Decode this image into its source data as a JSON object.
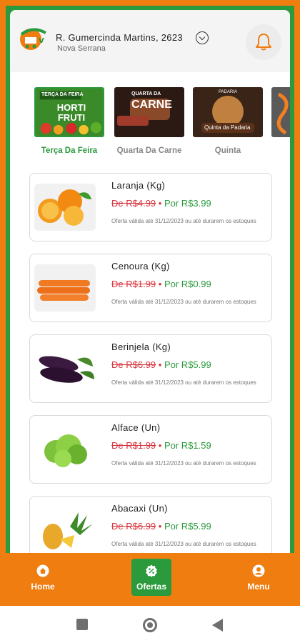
{
  "header": {
    "address": "R. Gumercinda Martins,  2623",
    "city": "Nova Serrana"
  },
  "categories": [
    {
      "label": "Terça Da Feira",
      "thumb_text_top": "TERÇA DA FEIRA",
      "thumb_text_main": "HORTI FRUTI",
      "active": true
    },
    {
      "label": "Quarta Da Carne",
      "thumb_text_top": "QUARTA DA",
      "thumb_text_main": "CARNE",
      "active": false
    },
    {
      "label": "Quinta",
      "thumb_text_top": "PADARIA",
      "thumb_text_main": "Quinta da Padaria",
      "active": false
    }
  ],
  "products": [
    {
      "name": "Laranja (Kg)",
      "old_price": "De R$4.99",
      "separator": "•",
      "new_price": "Por R$3.99",
      "validity": "Oferta válida até 31/12/2023  ou até durarem os estoques",
      "icon": "orange-fruit"
    },
    {
      "name": "Cenoura (Kg)",
      "old_price": "De R$1.99",
      "separator": "•",
      "new_price": "Por R$0.99",
      "validity": "Oferta válida até 31/12/2023  ou até durarem os estoques",
      "icon": "carrot"
    },
    {
      "name": "Berinjela (Kg)",
      "old_price": "De R$6.99",
      "separator": "•",
      "new_price": "Por R$5.99",
      "validity": "Oferta válida até 31/12/2023  ou até durarem os estoques",
      "icon": "eggplant"
    },
    {
      "name": "Alface (Un)",
      "old_price": "De R$1.99",
      "separator": "•",
      "new_price": "Por R$1.59",
      "validity": "Oferta válida até 31/12/2023  ou até durarem os estoques",
      "icon": "lettuce"
    },
    {
      "name": "Abacaxi (Un)",
      "old_price": "De R$6.99",
      "separator": "•",
      "new_price": "Por R$5.99",
      "validity": "Oferta válida até 31/12/2023  ou até durarem os estoques",
      "icon": "pineapple"
    }
  ],
  "nav": {
    "home": "Home",
    "ofertas": "Ofertas",
    "menu": "Menu"
  },
  "colors": {
    "brand_orange": "#ef7d10",
    "brand_green": "#2a9a3c",
    "price_old": "#d9303a"
  }
}
